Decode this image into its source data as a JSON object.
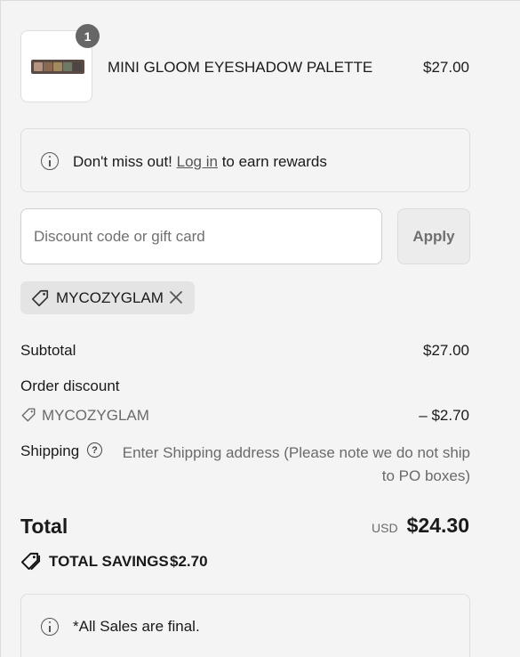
{
  "cart": {
    "item": {
      "quantity": "1",
      "name": "MINI GLOOM EYESHADOW PALETTE",
      "price": "$27.00",
      "thumbnail_icon": "eyeshadow-palette-image",
      "swatch_colors": [
        "#b49380",
        "#8c6a52",
        "#a28a5f",
        "#6e7a64",
        "#4d4644"
      ]
    }
  },
  "rewards_notice": {
    "icon": "info-icon",
    "prefix": "Don't miss out!",
    "link": "Log in",
    "suffix": "to earn rewards"
  },
  "discount": {
    "placeholder": "Discount code or gift card",
    "value": "",
    "apply_label": "Apply",
    "applied_code": "MYCOZYGLAM",
    "remove_icon": "close-icon"
  },
  "summary": {
    "subtotal_label": "Subtotal",
    "subtotal_value": "$27.00",
    "order_discount_label": "Order discount",
    "discount_code": "MYCOZYGLAM",
    "discount_value": "– $2.70",
    "shipping_label": "Shipping",
    "shipping_note_line1": "Enter Shipping address (Please note we do not ship",
    "shipping_note_line2": "to PO boxes)",
    "total_label": "Total",
    "total_currency": "USD",
    "total_value": "$24.30",
    "savings_label": "TOTAL SAVINGS",
    "savings_value": "$2.70"
  },
  "sales_notice": {
    "icon": "info-icon",
    "text": "*All Sales are final."
  }
}
